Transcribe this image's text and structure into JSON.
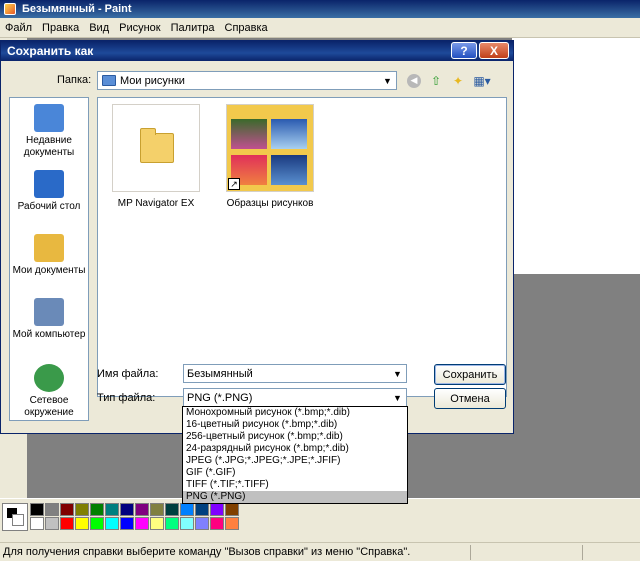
{
  "app": {
    "title": "Безымянный - Paint"
  },
  "menu": [
    "Файл",
    "Правка",
    "Вид",
    "Рисунок",
    "Палитра",
    "Справка"
  ],
  "dialog": {
    "title": "Сохранить как",
    "help_label": "?",
    "close_label": "X",
    "lookin_label": "Папка:",
    "lookin_value": "Мои рисунки",
    "places": [
      {
        "label": "Недавние документы",
        "icon": "recent-documents-icon",
        "color": "#4a86d8"
      },
      {
        "label": "Рабочий стол",
        "icon": "desktop-icon",
        "color": "#2a6ac8"
      },
      {
        "label": "Мои документы",
        "icon": "my-documents-icon",
        "color": "#e8b840"
      },
      {
        "label": "Мой компьютер",
        "icon": "my-computer-icon",
        "color": "#6a8ab8"
      },
      {
        "label": "Сетевое окружение",
        "icon": "network-icon",
        "color": "#3a9a4a"
      }
    ],
    "files": [
      {
        "name": "MP Navigator EX",
        "icon": "folder-icon"
      },
      {
        "name": "Образцы рисунков",
        "icon": "folder-shortcut-icon"
      }
    ],
    "filename_label": "Имя файла:",
    "filename_value": "Безымянный",
    "filetype_label": "Тип файла:",
    "filetype_value": "PNG (*.PNG)",
    "save_label": "Сохранить",
    "cancel_label": "Отмена",
    "filetype_options": [
      "Монохромный рисунок (*.bmp;*.dib)",
      "16-цветный рисунок (*.bmp;*.dib)",
      "256-цветный рисунок (*.bmp;*.dib)",
      "24-разрядный рисунок (*.bmp;*.dib)",
      "JPEG (*.JPG;*.JPEG;*.JPE;*.JFIF)",
      "GIF (*.GIF)",
      "TIFF (*.TIF;*.TIFF)",
      "PNG (*.PNG)"
    ]
  },
  "palette": [
    "#000000",
    "#808080",
    "#800000",
    "#808000",
    "#008000",
    "#008080",
    "#000080",
    "#800080",
    "#808040",
    "#004040",
    "#0080ff",
    "#004080",
    "#8000ff",
    "#804000",
    "#ffffff",
    "#c0c0c0",
    "#ff0000",
    "#ffff00",
    "#00ff00",
    "#00ffff",
    "#0000ff",
    "#ff00ff",
    "#ffff80",
    "#00ff80",
    "#80ffff",
    "#8080ff",
    "#ff0080",
    "#ff8040"
  ],
  "status": {
    "text": "Для получения справки выберите команду \"Вызов справки\" из меню \"Справка\"."
  }
}
